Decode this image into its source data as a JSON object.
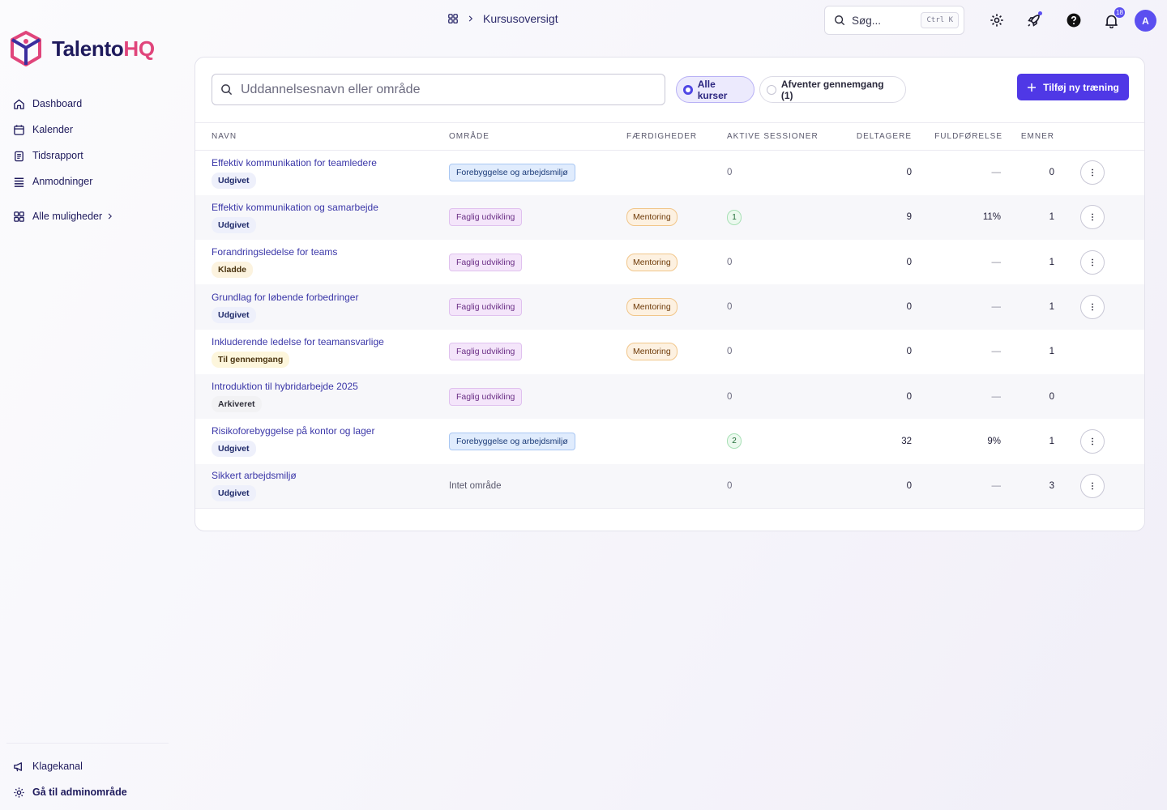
{
  "app": {
    "logo_main": "Talento",
    "logo_accent": "HQ"
  },
  "sidebar": {
    "items": [
      {
        "label": "Dashboard",
        "icon": "home-icon"
      },
      {
        "label": "Kalender",
        "icon": "calendar-icon"
      },
      {
        "label": "Tidsrapport",
        "icon": "clipboard-icon"
      },
      {
        "label": "Anmodninger",
        "icon": "list-icon"
      }
    ],
    "all_options": "Alle muligheder",
    "bottom": [
      {
        "label": "Klagekanal",
        "icon": "megaphone-icon"
      },
      {
        "label": "Gå til adminområde",
        "icon": "gear-icon"
      }
    ]
  },
  "header": {
    "breadcrumb": "Kursusoversigt",
    "search_placeholder": "Søg...",
    "search_shortcut": "Ctrl K",
    "notification_count": "18",
    "avatar_initial": "A"
  },
  "toolbar": {
    "search_placeholder": "Uddannelsesnavn eller område",
    "filter_all": "Alle kurser",
    "filter_pending": "Afventer gennemgang (1)",
    "add_button": "Tilføj ny træning"
  },
  "table": {
    "columns": [
      "NAVN",
      "OMRÅDE",
      "FÆRDIGHEDER",
      "AKTIVE SESSIONER",
      "DELTAGERE",
      "FULDFØRELSE",
      "EMNER"
    ],
    "rows": [
      {
        "name": "Effektiv kommunikation for teamledere",
        "status": "Udgivet",
        "status_kind": "pub",
        "area": "Forebyggelse og arbejdsmiljø",
        "area_kind": "fore",
        "skill": "",
        "sessions": "0",
        "sessions_pill": false,
        "participants": "0",
        "completion": "—",
        "topics": "0",
        "menu": true
      },
      {
        "name": "Effektiv kommunikation og samarbejde",
        "status": "Udgivet",
        "status_kind": "pub",
        "area": "Faglig udvikling",
        "area_kind": "fag",
        "skill": "Mentoring",
        "sessions": "1",
        "sessions_pill": true,
        "participants": "9",
        "completion": "11%",
        "topics": "1",
        "menu": true
      },
      {
        "name": "Forandringsledelse for teams",
        "status": "Kladde",
        "status_kind": "draft",
        "area": "Faglig udvikling",
        "area_kind": "fag",
        "skill": "Mentoring",
        "sessions": "0",
        "sessions_pill": false,
        "participants": "0",
        "completion": "—",
        "topics": "1",
        "menu": true
      },
      {
        "name": "Grundlag for løbende forbedringer",
        "status": "Udgivet",
        "status_kind": "pub",
        "area": "Faglig udvikling",
        "area_kind": "fag",
        "skill": "Mentoring",
        "sessions": "0",
        "sessions_pill": false,
        "participants": "0",
        "completion": "—",
        "topics": "1",
        "menu": true
      },
      {
        "name": "Inkluderende ledelse for teamansvarlige",
        "status": "Til gennemgang",
        "status_kind": "review",
        "area": "Faglig udvikling",
        "area_kind": "fag",
        "skill": "Mentoring",
        "sessions": "0",
        "sessions_pill": false,
        "participants": "0",
        "completion": "—",
        "topics": "1",
        "menu": false
      },
      {
        "name": "Introduktion til hybridarbejde 2025",
        "status": "Arkiveret",
        "status_kind": "arch",
        "area": "Faglig udvikling",
        "area_kind": "fag",
        "skill": "",
        "sessions": "0",
        "sessions_pill": false,
        "participants": "0",
        "completion": "—",
        "topics": "0",
        "menu": false
      },
      {
        "name": "Risikoforebyggelse på kontor og lager",
        "status": "Udgivet",
        "status_kind": "pub",
        "area": "Forebyggelse og arbejdsmiljø",
        "area_kind": "fore",
        "skill": "",
        "sessions": "2",
        "sessions_pill": true,
        "participants": "32",
        "completion": "9%",
        "topics": "1",
        "menu": true
      },
      {
        "name": "Sikkert arbejdsmiljø",
        "status": "Udgivet",
        "status_kind": "pub",
        "area": "Intet område",
        "area_kind": "none",
        "skill": "",
        "sessions": "0",
        "sessions_pill": false,
        "participants": "0",
        "completion": "—",
        "topics": "3",
        "menu": true
      }
    ]
  }
}
